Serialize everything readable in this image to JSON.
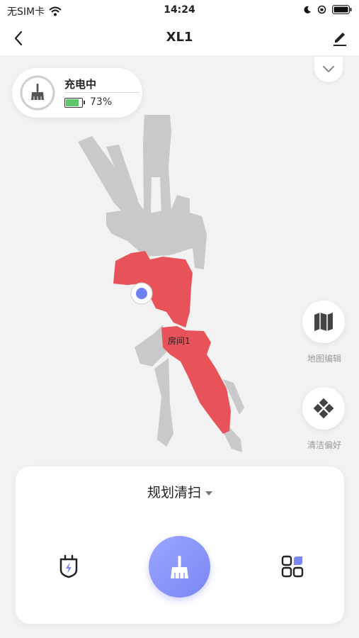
{
  "statusbar": {
    "carrier": "无SIM卡",
    "time": "14:24"
  },
  "navbar": {
    "title": "XL1"
  },
  "status_card": {
    "state": "充电中",
    "battery_percent": "73%",
    "battery_level": 0.73
  },
  "map": {
    "room_label": "房间1",
    "room_color": "#e8535a",
    "explored_color": "#c9c9c9",
    "robot_color": "#6f7ff2"
  },
  "side": {
    "map_edit_label": "地图编辑",
    "clean_pref_label": "清洁偏好"
  },
  "panel": {
    "mode_label": "规划清扫"
  },
  "colors": {
    "accent": "#7b87f4"
  }
}
